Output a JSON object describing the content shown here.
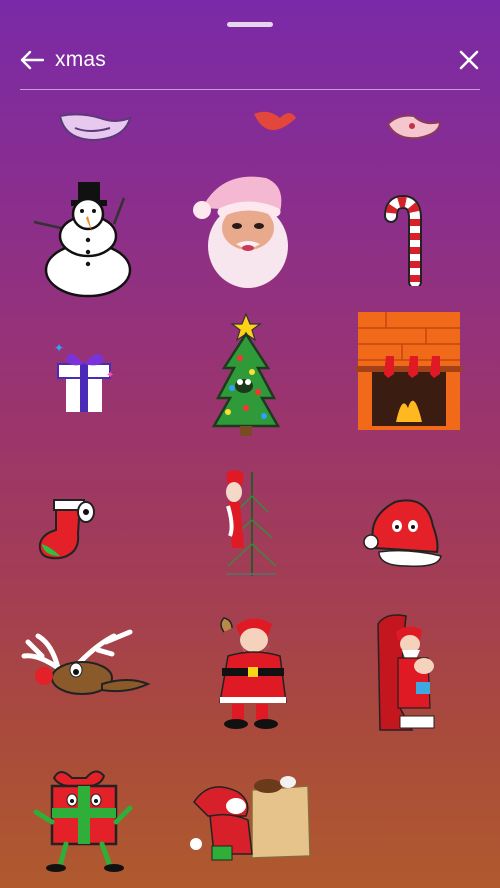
{
  "search": {
    "query": "xmas",
    "back_icon": "arrow-left-icon",
    "clear_icon": "close-icon"
  },
  "stickers": [
    "partial-sticker-left",
    "partial-sticker-center",
    "partial-sticker-right",
    "snowman",
    "santa-face",
    "candy-cane",
    "gift-box",
    "christmas-tree",
    "fireplace-stockings",
    "stocking",
    "santa-with-tree",
    "santa-hat",
    "reindeer",
    "santa-waving",
    "santa-in-chair",
    "present-character",
    "santa-with-bag"
  ],
  "colors": {
    "gradient_top": "#7a2aa8",
    "gradient_bottom": "#b05a2e",
    "text": "#ffffff"
  }
}
